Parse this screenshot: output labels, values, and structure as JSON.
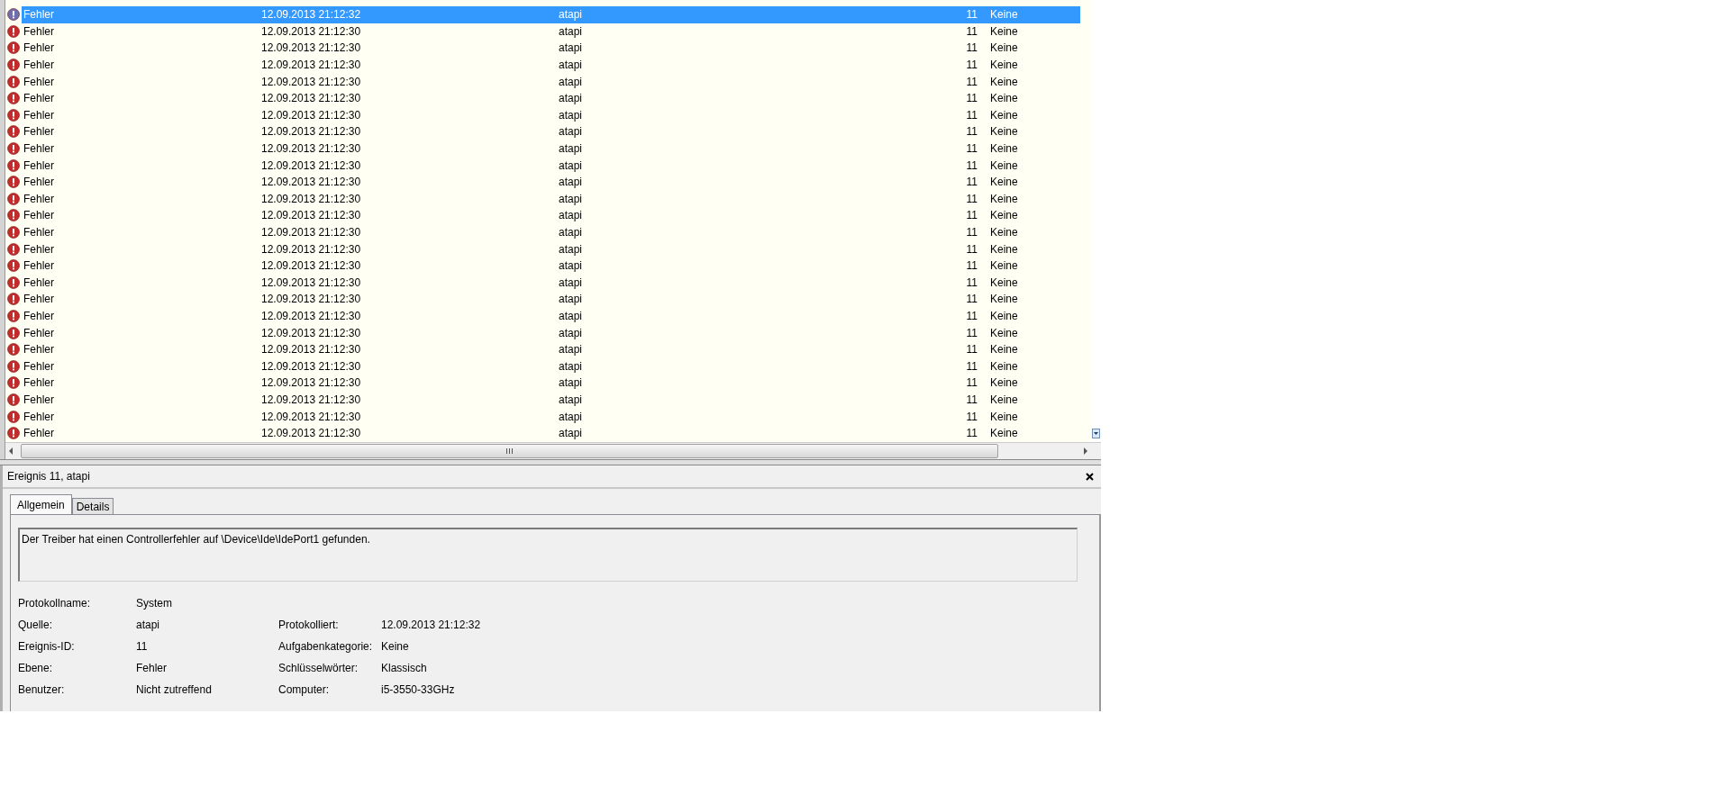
{
  "event_list": {
    "rows": [
      {
        "kind": "error",
        "level": "Fehler",
        "date": "12.09.2013 21:12:32",
        "source": "atapi",
        "event_id": "11",
        "category": "Keine",
        "selected": true
      },
      {
        "kind": "error",
        "level": "Fehler",
        "date": "12.09.2013 21:12:30",
        "source": "atapi",
        "event_id": "11",
        "category": "Keine",
        "selected": false
      },
      {
        "kind": "error",
        "level": "Fehler",
        "date": "12.09.2013 21:12:30",
        "source": "atapi",
        "event_id": "11",
        "category": "Keine",
        "selected": false
      },
      {
        "kind": "error",
        "level": "Fehler",
        "date": "12.09.2013 21:12:30",
        "source": "atapi",
        "event_id": "11",
        "category": "Keine",
        "selected": false
      },
      {
        "kind": "error",
        "level": "Fehler",
        "date": "12.09.2013 21:12:30",
        "source": "atapi",
        "event_id": "11",
        "category": "Keine",
        "selected": false
      },
      {
        "kind": "error",
        "level": "Fehler",
        "date": "12.09.2013 21:12:30",
        "source": "atapi",
        "event_id": "11",
        "category": "Keine",
        "selected": false
      },
      {
        "kind": "error",
        "level": "Fehler",
        "date": "12.09.2013 21:12:30",
        "source": "atapi",
        "event_id": "11",
        "category": "Keine",
        "selected": false
      },
      {
        "kind": "error",
        "level": "Fehler",
        "date": "12.09.2013 21:12:30",
        "source": "atapi",
        "event_id": "11",
        "category": "Keine",
        "selected": false
      },
      {
        "kind": "error",
        "level": "Fehler",
        "date": "12.09.2013 21:12:30",
        "source": "atapi",
        "event_id": "11",
        "category": "Keine",
        "selected": false
      },
      {
        "kind": "error",
        "level": "Fehler",
        "date": "12.09.2013 21:12:30",
        "source": "atapi",
        "event_id": "11",
        "category": "Keine",
        "selected": false
      },
      {
        "kind": "error",
        "level": "Fehler",
        "date": "12.09.2013 21:12:30",
        "source": "atapi",
        "event_id": "11",
        "category": "Keine",
        "selected": false
      },
      {
        "kind": "error",
        "level": "Fehler",
        "date": "12.09.2013 21:12:30",
        "source": "atapi",
        "event_id": "11",
        "category": "Keine",
        "selected": false
      },
      {
        "kind": "error",
        "level": "Fehler",
        "date": "12.09.2013 21:12:30",
        "source": "atapi",
        "event_id": "11",
        "category": "Keine",
        "selected": false
      },
      {
        "kind": "error",
        "level": "Fehler",
        "date": "12.09.2013 21:12:30",
        "source": "atapi",
        "event_id": "11",
        "category": "Keine",
        "selected": false
      },
      {
        "kind": "error",
        "level": "Fehler",
        "date": "12.09.2013 21:12:30",
        "source": "atapi",
        "event_id": "11",
        "category": "Keine",
        "selected": false
      },
      {
        "kind": "error",
        "level": "Fehler",
        "date": "12.09.2013 21:12:30",
        "source": "atapi",
        "event_id": "11",
        "category": "Keine",
        "selected": false
      },
      {
        "kind": "error",
        "level": "Fehler",
        "date": "12.09.2013 21:12:30",
        "source": "atapi",
        "event_id": "11",
        "category": "Keine",
        "selected": false
      },
      {
        "kind": "error",
        "level": "Fehler",
        "date": "12.09.2013 21:12:30",
        "source": "atapi",
        "event_id": "11",
        "category": "Keine",
        "selected": false
      },
      {
        "kind": "error",
        "level": "Fehler",
        "date": "12.09.2013 21:12:30",
        "source": "atapi",
        "event_id": "11",
        "category": "Keine",
        "selected": false
      },
      {
        "kind": "error",
        "level": "Fehler",
        "date": "12.09.2013 21:12:30",
        "source": "atapi",
        "event_id": "11",
        "category": "Keine",
        "selected": false
      },
      {
        "kind": "error",
        "level": "Fehler",
        "date": "12.09.2013 21:12:30",
        "source": "atapi",
        "event_id": "11",
        "category": "Keine",
        "selected": false
      },
      {
        "kind": "error",
        "level": "Fehler",
        "date": "12.09.2013 21:12:30",
        "source": "atapi",
        "event_id": "11",
        "category": "Keine",
        "selected": false
      },
      {
        "kind": "error",
        "level": "Fehler",
        "date": "12.09.2013 21:12:30",
        "source": "atapi",
        "event_id": "11",
        "category": "Keine",
        "selected": false
      },
      {
        "kind": "error",
        "level": "Fehler",
        "date": "12.09.2013 21:12:30",
        "source": "atapi",
        "event_id": "11",
        "category": "Keine",
        "selected": false
      },
      {
        "kind": "error",
        "level": "Fehler",
        "date": "12.09.2013 21:12:30",
        "source": "atapi",
        "event_id": "11",
        "category": "Keine",
        "selected": false
      },
      {
        "kind": "error",
        "level": "Fehler",
        "date": "12.09.2013 21:12:30",
        "source": "atapi",
        "event_id": "11",
        "category": "Keine",
        "selected": false
      }
    ]
  },
  "detail": {
    "title": "Ereignis 11, atapi",
    "tabs": [
      {
        "label": "Allgemein",
        "selected": true
      },
      {
        "label": "Details",
        "selected": false
      }
    ],
    "message": "Der Treiber hat einen Controllerfehler auf \\Device\\Ide\\IdePort1 gefunden.",
    "properties": [
      {
        "left": {
          "label": "Protokollname:",
          "value": "System"
        }
      },
      {
        "left": {
          "label": "Quelle:",
          "value": "atapi"
        },
        "right": {
          "label": "Protokolliert:",
          "value": "12.09.2013 21:12:32"
        }
      },
      {
        "left": {
          "label": "Ereignis-ID:",
          "value": "11"
        },
        "right": {
          "label": "Aufgabenkategorie:",
          "value": "Keine"
        }
      },
      {
        "left": {
          "label": "Ebene:",
          "value": "Fehler"
        },
        "right": {
          "label": "Schlüsselwörter:",
          "value": "Klassisch"
        }
      },
      {
        "left": {
          "label": "Benutzer:",
          "value": "Nicht zutreffend"
        },
        "right": {
          "label": "Computer:",
          "value": "i5-3550-33GHz"
        }
      }
    ]
  }
}
